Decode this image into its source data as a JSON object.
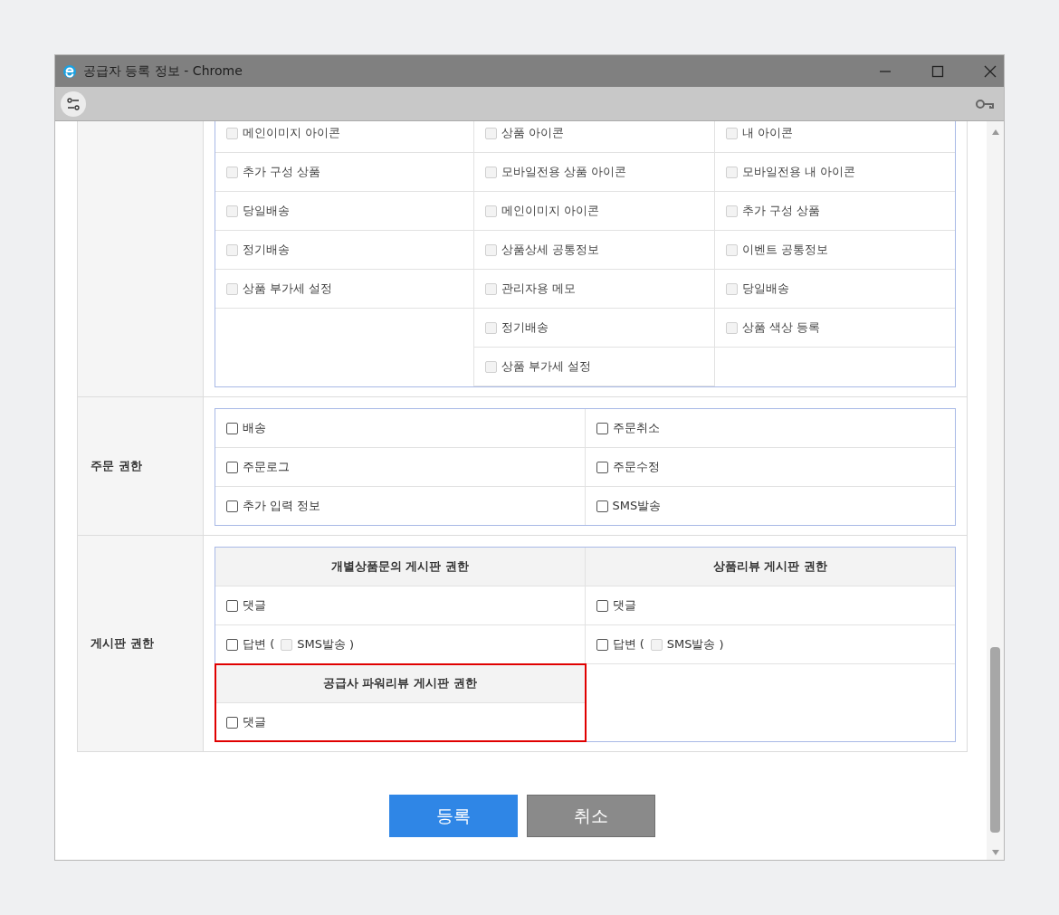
{
  "window": {
    "title": "공급자 등록 정보 - Chrome"
  },
  "sections": [
    {
      "kind": "columns",
      "columns": [
        [
          {
            "label": "메인이미지 아이콘",
            "checked": false,
            "disabled": true
          },
          {
            "label": "추가 구성 상품",
            "checked": false,
            "disabled": true
          },
          {
            "label": "당일배송",
            "checked": false,
            "disabled": true
          },
          {
            "label": "정기배송",
            "checked": false,
            "disabled": true
          },
          {
            "label": "상품 부가세 설정",
            "checked": false,
            "disabled": true
          }
        ],
        [
          {
            "label": "상품 아이콘",
            "checked": false,
            "disabled": true
          },
          {
            "label": "모바일전용 상품 아이콘",
            "checked": false,
            "disabled": true
          },
          {
            "label": "메인이미지 아이콘",
            "checked": false,
            "disabled": true
          },
          {
            "label": "상품상세 공통정보",
            "checked": false,
            "disabled": true
          },
          {
            "label": "관리자용 메모",
            "checked": false,
            "disabled": true
          },
          {
            "label": "정기배송",
            "checked": false,
            "disabled": true
          },
          {
            "label": "상품 부가세 설정",
            "checked": false,
            "disabled": true
          }
        ],
        [
          {
            "label": "내 아이콘",
            "checked": false,
            "disabled": true
          },
          {
            "label": "모바일전용 내 아이콘",
            "checked": false,
            "disabled": true
          },
          {
            "label": "추가 구성 상품",
            "checked": false,
            "disabled": true
          },
          {
            "label": "이벤트 공통정보",
            "checked": false,
            "disabled": true
          },
          {
            "label": "당일배송",
            "checked": false,
            "disabled": true
          },
          {
            "label": "상품 색상 등록",
            "checked": false,
            "disabled": true
          }
        ]
      ]
    },
    {
      "kind": "grid",
      "label": "주문 권한",
      "items": [
        {
          "label": "배송",
          "checked": false,
          "disabled": false
        },
        {
          "label": "주문취소",
          "checked": false,
          "disabled": false
        },
        {
          "label": "주문로그",
          "checked": false,
          "disabled": false
        },
        {
          "label": "주문수정",
          "checked": false,
          "disabled": false
        },
        {
          "label": "추가 입력 정보",
          "checked": false,
          "disabled": false
        },
        {
          "label": "SMS발송",
          "checked": false,
          "disabled": false
        }
      ]
    },
    {
      "kind": "boards",
      "label": "게시판 권한",
      "boards": [
        {
          "title": "개별상품문의 게시판 권한",
          "highlighted": false,
          "items": [
            {
              "label": "댓글",
              "checked": false,
              "disabled": false
            },
            {
              "label": "답변 (",
              "checked": false,
              "disabled": false,
              "sub": {
                "label": "SMS발송",
                "checked": false,
                "disabled": true
              },
              "close": ")"
            }
          ]
        },
        {
          "title": "상품리뷰 게시판 권한",
          "highlighted": false,
          "items": [
            {
              "label": "댓글",
              "checked": false,
              "disabled": false
            },
            {
              "label": "답변 (",
              "checked": false,
              "disabled": false,
              "sub": {
                "label": "SMS발송",
                "checked": false,
                "disabled": true
              },
              "close": ")"
            }
          ]
        },
        {
          "title": "공급사 파워리뷰 게시판 권한",
          "highlighted": true,
          "items": [
            {
              "label": "댓글",
              "checked": false,
              "disabled": false
            }
          ]
        }
      ]
    }
  ],
  "buttons": [
    {
      "label": "등록",
      "kind": "primary"
    },
    {
      "label": "취소",
      "kind": "secondary"
    }
  ]
}
